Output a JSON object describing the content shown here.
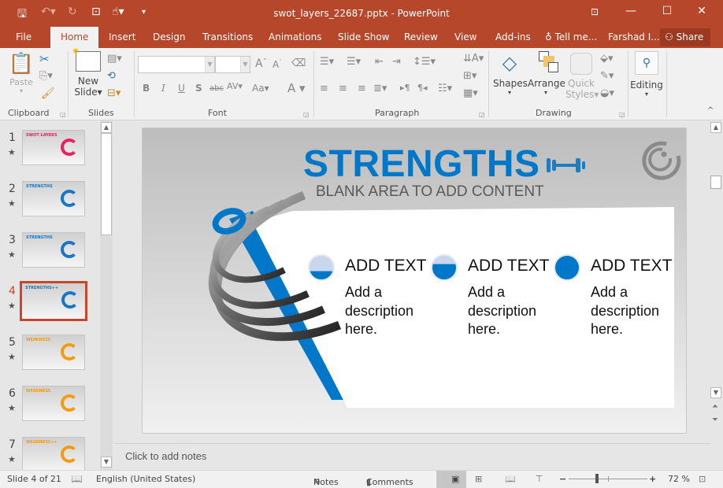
{
  "window": {
    "title": "swot_layers_22687.pptx - PowerPoint",
    "quick_access": [
      "save-icon",
      "undo-icon",
      "redo-icon",
      "present-from-start-icon",
      "touch-mode-icon",
      "customize-icon"
    ]
  },
  "tabs": [
    {
      "label": "File"
    },
    {
      "label": "Home",
      "active": true
    },
    {
      "label": "Insert"
    },
    {
      "label": "Design"
    },
    {
      "label": "Transitions"
    },
    {
      "label": "Animations"
    },
    {
      "label": "Slide Show"
    },
    {
      "label": "Review"
    },
    {
      "label": "View"
    },
    {
      "label": "Add-ins"
    }
  ],
  "tell_me": "Tell me...",
  "user": "Farshad I...",
  "share_label": "Share",
  "ribbon": {
    "groups": {
      "clipboard": "Clipboard",
      "slides": "Slides",
      "font": "Font",
      "paragraph": "Paragraph",
      "drawing": "Drawing"
    },
    "paste": "Paste",
    "new_slide_1": "New",
    "new_slide_2": "Slide",
    "font_name": "",
    "font_size": "",
    "shapes": "Shapes",
    "arrange": "Arrange",
    "quick_styles_1": "Quick",
    "quick_styles_2": "Styles",
    "editing": "Editing"
  },
  "thumbnails": [
    {
      "num": "1",
      "title": "SWOT LAYERS",
      "accent": "#e91e63"
    },
    {
      "num": "2",
      "title": "STRENGTHS",
      "accent": "#1976c4"
    },
    {
      "num": "3",
      "title": "STRENGTHS",
      "accent": "#1976c4"
    },
    {
      "num": "4",
      "title": "STRENGTHS++",
      "accent": "#1976c4",
      "selected": true
    },
    {
      "num": "5",
      "title": "WEAKNESS",
      "accent": "#f39c12"
    },
    {
      "num": "6",
      "title": "WEAKNESS",
      "accent": "#f39c12"
    },
    {
      "num": "7",
      "title": "WEAKNESS++",
      "accent": "#f39c12"
    }
  ],
  "slide": {
    "title": "STRENGTHS",
    "subtitle": "BLANK AREA TO ADD CONTENT",
    "accent": "#0077c8",
    "items": [
      {
        "heading": "ADD TEXT",
        "desc": [
          "Add a",
          "description",
          "here."
        ],
        "fill_level": 0.35
      },
      {
        "heading": "ADD TEXT",
        "desc": [
          "Add a",
          "description",
          "here."
        ],
        "fill_level": 0.65
      },
      {
        "heading": "ADD TEXT",
        "desc": [
          "Add a",
          "description",
          "here."
        ],
        "fill_level": 1.0
      }
    ]
  },
  "notes_placeholder": "Click to add notes",
  "status": {
    "slide_info": "Slide 4 of 21",
    "language": "English (United States)",
    "notes": "Notes",
    "comments": "Comments",
    "zoom": "72 %",
    "zoom_level": 0.72
  }
}
